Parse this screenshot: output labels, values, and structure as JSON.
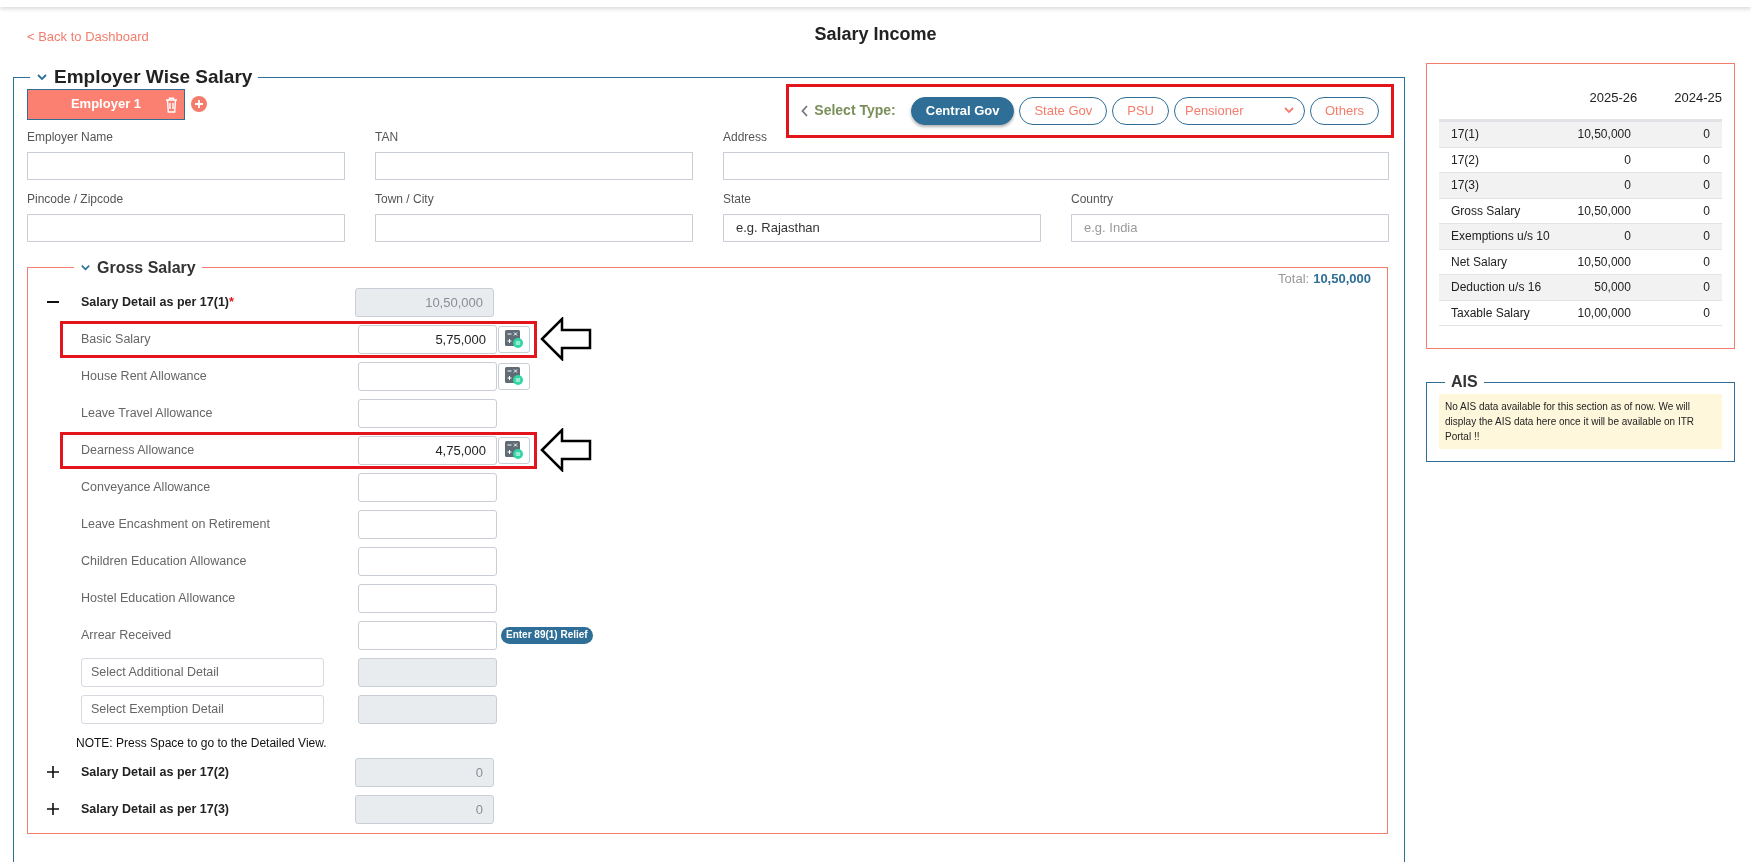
{
  "back_link": "< Back to Dashboard",
  "page_title": "Salary Income",
  "employer_section": {
    "title": "Employer Wise Salary",
    "expanded": true,
    "employers": [
      {
        "label": "Employer 1",
        "selected": true
      }
    ],
    "type_selector": {
      "label": "Select Type:",
      "highlighted": true,
      "options": [
        {
          "label": "Central Gov",
          "kind": "button",
          "selected": true
        },
        {
          "label": "State Gov",
          "kind": "button",
          "selected": false
        },
        {
          "label": "PSU",
          "kind": "button",
          "selected": false
        },
        {
          "label": "Pensioner",
          "kind": "dropdown",
          "selected": false
        },
        {
          "label": "Others",
          "kind": "button",
          "selected": false
        }
      ]
    },
    "fields": [
      {
        "label": "Employer Name",
        "kind": "input",
        "wide": false
      },
      {
        "label": "TAN",
        "kind": "input",
        "wide": false
      },
      {
        "label": "Address",
        "kind": "input",
        "wide": true
      },
      {
        "label": "Pincode / Zipcode",
        "kind": "input",
        "wide": false
      },
      {
        "label": "Town / City",
        "kind": "input",
        "wide": false
      },
      {
        "label": "State",
        "kind": "select",
        "wide": false,
        "placeholder": "e.g. Rajasthan"
      },
      {
        "label": "Country",
        "kind": "input",
        "wide": false,
        "placeholder": "e.g. India"
      }
    ]
  },
  "gross_salary": {
    "title": "Gross Salary",
    "expanded": true,
    "total_label": "Total:",
    "total_value": "10,50,000",
    "sections": [
      {
        "label": "Salary Detail as per 17(1)",
        "required_mark": "*",
        "expanded": true,
        "value": "10,50,000",
        "rows": [
          {
            "kind": "amount",
            "label": "Basic Salary",
            "value": "5,75,000",
            "calculator": true,
            "highlighted": true
          },
          {
            "kind": "amount",
            "label": "House Rent Allowance",
            "calculator": true,
            "highlighted": false
          },
          {
            "kind": "amount",
            "label": "Leave Travel Allowance",
            "calculator": false,
            "highlighted": false
          },
          {
            "kind": "amount",
            "label": "Dearness Allowance",
            "value": "4,75,000",
            "calculator": true,
            "highlighted": true
          },
          {
            "kind": "amount",
            "label": "Conveyance Allowance",
            "calculator": false,
            "highlighted": false
          },
          {
            "kind": "amount",
            "label": "Leave Encashment on Retirement",
            "calculator": false,
            "highlighted": false
          },
          {
            "kind": "amount",
            "label": "Children Education Allowance",
            "calculator": false,
            "highlighted": false
          },
          {
            "kind": "amount",
            "label": "Hostel Education Allowance",
            "calculator": false,
            "highlighted": false
          },
          {
            "kind": "relief",
            "label": "Arrear Received",
            "action": "Enter 89(1) Relief",
            "highlighted": false
          },
          {
            "kind": "select",
            "placeholder": "Select Additional Detail",
            "highlighted": false
          },
          {
            "kind": "select",
            "placeholder": "Select Exemption Detail",
            "highlighted": false
          }
        ],
        "note": "NOTE: Press Space to go to the Detailed View."
      },
      {
        "label": "Salary Detail as per 17(2)",
        "expanded": false,
        "value": "0"
      },
      {
        "label": "Salary Detail as per 17(3)",
        "expanded": false,
        "value": "0"
      }
    ]
  },
  "summary": {
    "columns": [
      "2025-26",
      "2024-25"
    ],
    "rows": [
      {
        "label": "17(1)",
        "values": [
          "10,50,000",
          "0"
        ]
      },
      {
        "label": "17(2)",
        "values": [
          "0",
          "0"
        ]
      },
      {
        "label": "17(3)",
        "values": [
          "0",
          "0"
        ]
      },
      {
        "label": "Gross Salary",
        "values": [
          "10,50,000",
          "0"
        ]
      },
      {
        "label": "Exemptions u/s 10",
        "values": [
          "0",
          "0"
        ]
      },
      {
        "label": "Net Salary",
        "values": [
          "10,50,000",
          "0"
        ]
      },
      {
        "label": "Deduction u/s 16",
        "values": [
          "50,000",
          "0"
        ]
      },
      {
        "label": "Taxable Salary",
        "values": [
          "10,00,000",
          "0"
        ]
      }
    ]
  },
  "ais": {
    "title": "AIS",
    "message": "No AIS data available for this section as of now. We will display the AIS data here once it will be available on ITR Portal !!"
  }
}
